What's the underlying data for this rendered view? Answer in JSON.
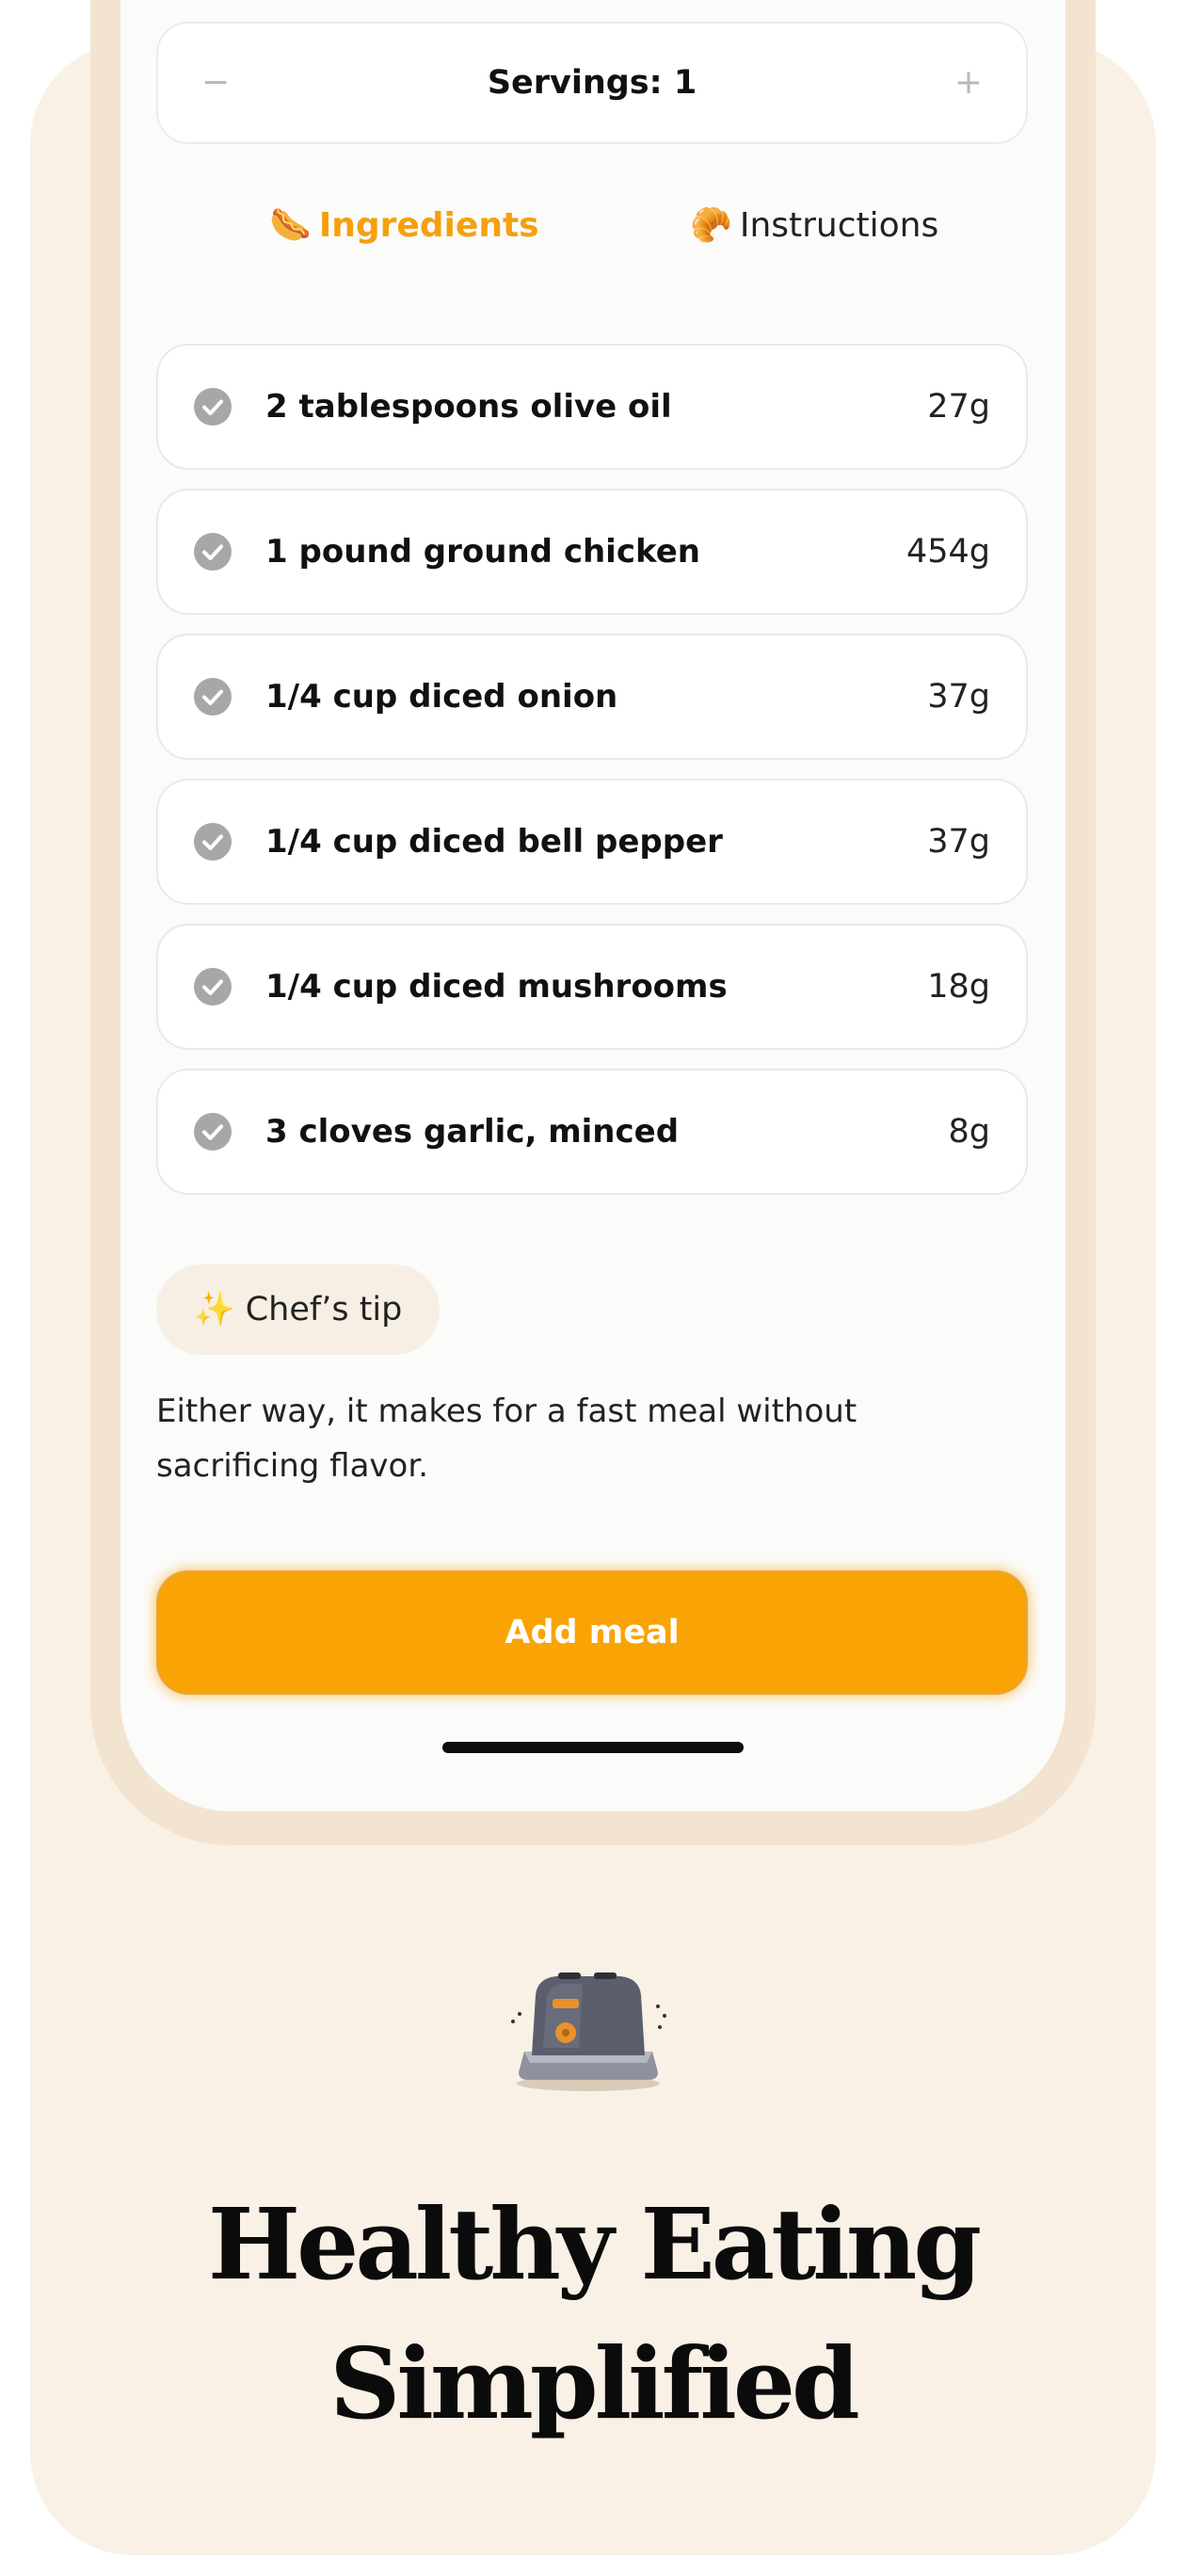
{
  "servings": {
    "minus_label": "−",
    "label": "Servings: 1",
    "plus_label": "+"
  },
  "tabs": [
    {
      "icon": "🌭",
      "label": "Ingredients",
      "active": true
    },
    {
      "icon": "🥐",
      "label": "Instructions",
      "active": false
    }
  ],
  "ingredients": [
    {
      "name": "2 tablespoons olive oil",
      "grams": "27g"
    },
    {
      "name": "1 pound ground chicken",
      "grams": "454g"
    },
    {
      "name": "1/4 cup diced onion",
      "grams": "37g"
    },
    {
      "name": "1/4 cup diced bell pepper",
      "grams": "37g"
    },
    {
      "name": "1/4 cup diced mushrooms",
      "grams": "18g"
    },
    {
      "name": "3 cloves garlic, minced",
      "grams": "8g"
    }
  ],
  "chef_tip": {
    "icon": "✨",
    "label": "Chef’s tip",
    "text": "Either way, it makes for a fast meal without sacrificing flavor."
  },
  "add_meal_label": "Add meal",
  "headline": {
    "line1": "Healthy Eating",
    "line2": "Simplified"
  },
  "colors": {
    "accent": "#f9a304",
    "background": "#f9f1e6",
    "frame": "#f3e4d1"
  }
}
